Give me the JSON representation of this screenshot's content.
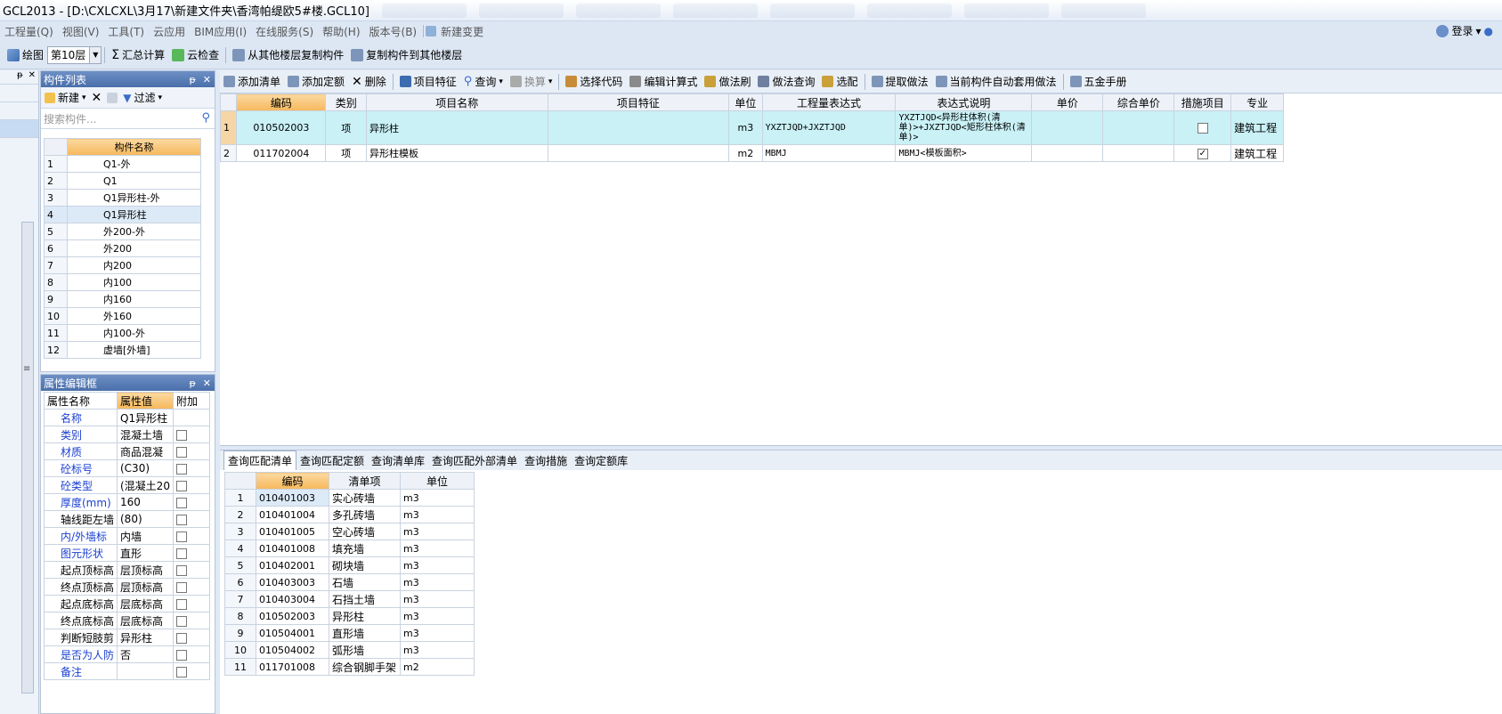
{
  "window": {
    "title": "GCL2013 - [D:\\CXLCXL\\3月17\\新建文件夹\\香湾帕缇欧5#楼.GCL10]"
  },
  "menu": {
    "items": [
      "工程量(Q)",
      "视图(V)",
      "工具(T)",
      "云应用",
      "BIM应用(I)",
      "在线服务(S)",
      "帮助(H)",
      "版本号(B)",
      "新建变更"
    ],
    "login": "登录"
  },
  "toolbar1": {
    "draw": "绘图",
    "floor": "第10层",
    "summary": "汇总计算",
    "cloud_check": "云检查",
    "copy_from": "从其他楼层复制构件",
    "copy_to": "复制构件到其他楼层"
  },
  "component_panel": {
    "title": "构件列表",
    "new": "新建",
    "filter": "过滤",
    "search_placeholder": "搜索构件...",
    "column": "构件名称",
    "rows": [
      {
        "n": "1",
        "name": "Q1-外"
      },
      {
        "n": "2",
        "name": "Q1"
      },
      {
        "n": "3",
        "name": "Q1异形柱-外"
      },
      {
        "n": "4",
        "name": "Q1异形柱"
      },
      {
        "n": "5",
        "name": "外200-外"
      },
      {
        "n": "6",
        "name": "外200"
      },
      {
        "n": "7",
        "name": "内200"
      },
      {
        "n": "8",
        "name": "内100"
      },
      {
        "n": "9",
        "name": "内160"
      },
      {
        "n": "10",
        "name": "外160"
      },
      {
        "n": "11",
        "name": "内100-外"
      },
      {
        "n": "12",
        "name": "虚墙[外墙]"
      }
    ]
  },
  "property_panel": {
    "title": "属性编辑框",
    "col_name": "属性名称",
    "col_value": "属性值",
    "col_extra": "附加",
    "rows": [
      {
        "name": "名称",
        "value": "Q1异形柱",
        "blue": true,
        "cb": false
      },
      {
        "name": "类别",
        "value": "混凝土墙",
        "blue": true,
        "cb": true
      },
      {
        "name": "材质",
        "value": "商品混凝",
        "blue": true,
        "cb": true
      },
      {
        "name": "砼标号",
        "value": "(C30)",
        "blue": true,
        "cb": true
      },
      {
        "name": "砼类型",
        "value": "(混凝土20",
        "blue": true,
        "cb": true
      },
      {
        "name": "厚度(mm)",
        "value": "160",
        "blue": true,
        "cb": true
      },
      {
        "name": "轴线距左墙",
        "value": "(80)",
        "blue": false,
        "cb": true
      },
      {
        "name": "内/外墙标",
        "value": "内墙",
        "blue": true,
        "cb": true
      },
      {
        "name": "图元形状",
        "value": "直形",
        "blue": true,
        "cb": true
      },
      {
        "name": "起点顶标高",
        "value": "层顶标高",
        "blue": false,
        "cb": true
      },
      {
        "name": "终点顶标高",
        "value": "层顶标高",
        "blue": false,
        "cb": true
      },
      {
        "name": "起点底标高",
        "value": "层底标高",
        "blue": false,
        "cb": true
      },
      {
        "name": "终点底标高",
        "value": "层底标高",
        "blue": false,
        "cb": true
      },
      {
        "name": "判断短肢剪",
        "value": "异形柱",
        "blue": false,
        "cb": true
      },
      {
        "name": "是否为人防",
        "value": "否",
        "blue": true,
        "cb": true
      },
      {
        "name": "备注",
        "value": "",
        "blue": true,
        "cb": true
      }
    ]
  },
  "main_toolbar": {
    "items": [
      "添加清单",
      "添加定额",
      "删除",
      "项目特征",
      "查询",
      "换算",
      "选择代码",
      "编辑计算式",
      "做法刷",
      "做法查询",
      "选配",
      "提取做法",
      "当前构件自动套用做法",
      "五金手册"
    ]
  },
  "main_grid": {
    "headers": [
      "编码",
      "类别",
      "项目名称",
      "项目特征",
      "单位",
      "工程量表达式",
      "表达式说明",
      "单价",
      "综合单价",
      "措施项目",
      "专业"
    ],
    "rows": [
      {
        "n": "1",
        "code": "010502003",
        "type": "项",
        "name": "异形柱",
        "feature": "",
        "unit": "m3",
        "expr": "YXZTJQD+JXZTJQD",
        "desc": "YXZTJQD<异形柱体积(清单)>+JXZTJQD<矩形柱体积(清单)>",
        "price": "",
        "total": "",
        "measure": false,
        "major": "建筑工程"
      },
      {
        "n": "2",
        "code": "011702004",
        "type": "项",
        "name": "异形柱模板",
        "feature": "",
        "unit": "m2",
        "expr": "MBMJ",
        "desc": "MBMJ<模板面积>",
        "price": "",
        "total": "",
        "measure": true,
        "major": "建筑工程"
      }
    ]
  },
  "bottom_tabs": [
    "查询匹配清单",
    "查询匹配定额",
    "查询清单库",
    "查询匹配外部清单",
    "查询措施",
    "查询定额库"
  ],
  "bottom_grid": {
    "headers": [
      "编码",
      "清单项",
      "单位"
    ],
    "rows": [
      {
        "n": "1",
        "code": "010401003",
        "name": "实心砖墙",
        "unit": "m3"
      },
      {
        "n": "2",
        "code": "010401004",
        "name": "多孔砖墙",
        "unit": "m3"
      },
      {
        "n": "3",
        "code": "010401005",
        "name": "空心砖墙",
        "unit": "m3"
      },
      {
        "n": "4",
        "code": "010401008",
        "name": "填充墙",
        "unit": "m3"
      },
      {
        "n": "5",
        "code": "010402001",
        "name": "砌块墙",
        "unit": "m3"
      },
      {
        "n": "6",
        "code": "010403003",
        "name": "石墙",
        "unit": "m3"
      },
      {
        "n": "7",
        "code": "010403004",
        "name": "石挡土墙",
        "unit": "m3"
      },
      {
        "n": "8",
        "code": "010502003",
        "name": "异形柱",
        "unit": "m3"
      },
      {
        "n": "9",
        "code": "010504001",
        "name": "直形墙",
        "unit": "m3"
      },
      {
        "n": "10",
        "code": "010504002",
        "name": "弧形墙",
        "unit": "m3"
      },
      {
        "n": "11",
        "code": "011701008",
        "name": "综合钢脚手架",
        "unit": "m2"
      }
    ]
  },
  "colors": {
    "header_orange": "#f6b85c",
    "selection": "#c9f1f6",
    "panel_header": "#4a6faa"
  }
}
